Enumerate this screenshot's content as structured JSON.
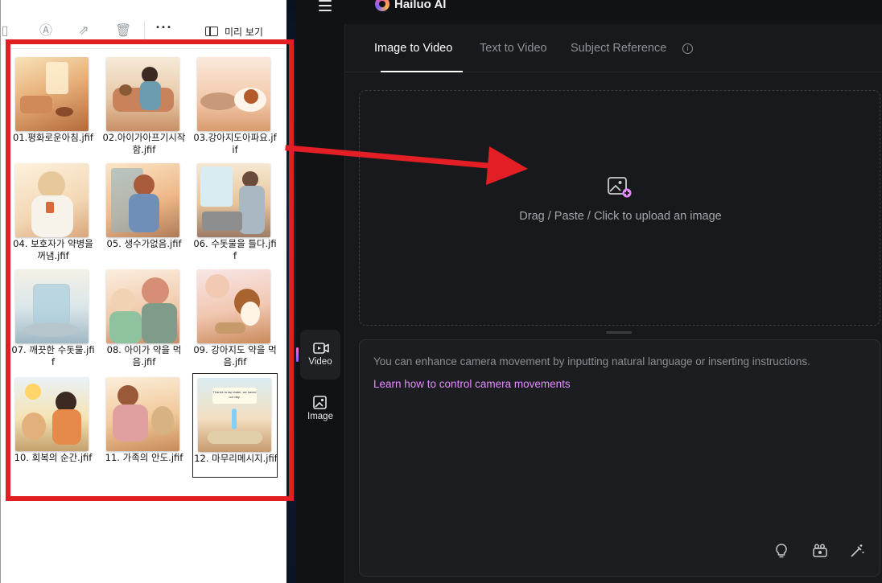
{
  "explorer": {
    "more_label": "···",
    "preview_label": "미리 보기",
    "files": [
      {
        "name": "01.평화로운아침.jfif"
      },
      {
        "name": "02.아이가아프기시작함.jfif"
      },
      {
        "name": "03.강아지도아파요.jfif"
      },
      {
        "name": "04. 보호자가 약병을 꺼냄.jfif"
      },
      {
        "name": "05. 생수가없음.jfif"
      },
      {
        "name": "06. 수돗물을 틀다.jfif"
      },
      {
        "name": "07. 깨끗한 수돗물.jfif"
      },
      {
        "name": "08. 아이가 약을 먹음.jfif"
      },
      {
        "name": "09. 강아지도 약을 먹음.jfif"
      },
      {
        "name": "10. 회복의 순간.jfif"
      },
      {
        "name": "11. 가족의 안도.jfif"
      },
      {
        "name": "12. 마무리메시지.jfif",
        "selected": true
      }
    ],
    "thumb12_banner": "Thanks to tap water, we saved our day.",
    "highlight_color": "#e31e24"
  },
  "app": {
    "logo_text": "Hailuo AI",
    "tabs": [
      {
        "label": "Image to Video",
        "active": true
      },
      {
        "label": "Text to Video"
      },
      {
        "label": "Subject Reference"
      }
    ],
    "upload_text": "Drag / Paste / Click to upload an image",
    "prompt_placeholder": "You can enhance camera movement by inputting natural language or inserting instructions.",
    "prompt_link": "Learn how to control camera movements",
    "side_nav": [
      {
        "label": "Video",
        "icon": "video-icon",
        "active": true
      },
      {
        "label": "Image",
        "icon": "image-icon"
      }
    ],
    "prompt_tools": [
      "bulb-icon",
      "camera-icon",
      "magic-wand-icon"
    ],
    "colors": {
      "link": "#e58cff",
      "background": "#111214",
      "panel": "#18191c"
    }
  }
}
